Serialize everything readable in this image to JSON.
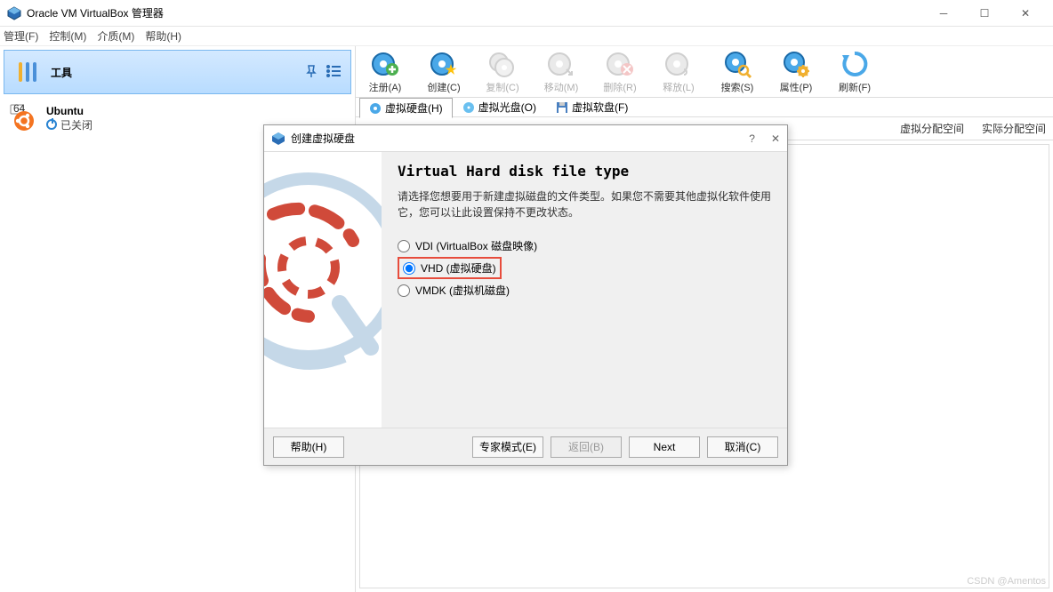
{
  "window": {
    "title": "Oracle VM VirtualBox 管理器"
  },
  "menu": {
    "file": "管理(F)",
    "ctrl": "控制(M)",
    "media": "介质(M)",
    "help": "帮助(H)"
  },
  "sidebar": {
    "tools_label": "工具",
    "vm": {
      "name": "Ubuntu",
      "status": "已关闭",
      "badge": "64"
    }
  },
  "toolbar": {
    "register": "注册(A)",
    "create": "创建(C)",
    "copy": "复制(C)",
    "move": "移动(M)",
    "delete": "删除(R)",
    "release": "释放(L)",
    "search": "搜索(S)",
    "props": "属性(P)",
    "refresh": "刷新(F)"
  },
  "filtertabs": {
    "hdd": "虚拟硬盘(H)",
    "optical": "虚拟光盘(O)",
    "floppy": "虚拟软盘(F)"
  },
  "table": {
    "col1": "虚拟分配空间",
    "col2": "实际分配空间"
  },
  "dialog": {
    "title": "创建虚拟硬盘",
    "heading": "Virtual Hard disk file type",
    "desc": "请选择您想要用于新建虚拟磁盘的文件类型。如果您不需要其他虚拟化软件使用它，您可以让此设置保持不更改状态。",
    "opt_vdi": "VDI (VirtualBox 磁盘映像)",
    "opt_vhd": "VHD (虚拟硬盘)",
    "opt_vmdk": "VMDK (虚拟机磁盘)",
    "btn_help": "帮助(H)",
    "btn_expert": "专家模式(E)",
    "btn_back": "返回(B)",
    "btn_next": "Next",
    "btn_cancel": "取消(C)"
  },
  "watermark": "CSDN @Amentos"
}
